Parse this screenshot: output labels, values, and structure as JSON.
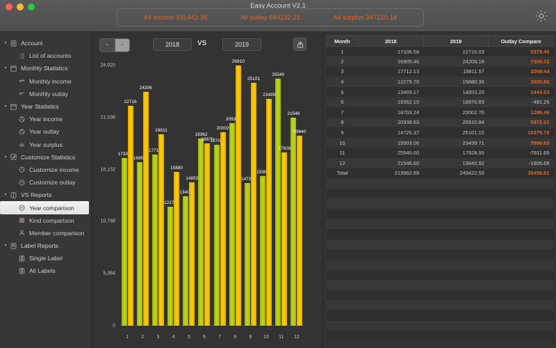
{
  "window": {
    "title": "Easy Account V2.1",
    "traffic_lights": [
      "close",
      "minimize",
      "zoom"
    ],
    "gear_icon": "gear-icon"
  },
  "summary": {
    "income": "All income 931442.35",
    "outlay": "All outlay 684232.21",
    "surplus": "All surplus 247210.14",
    "accent_color": "#e8651b"
  },
  "sidebar": {
    "items": [
      {
        "label": "Account",
        "level": "group",
        "icon": "list-icon",
        "caret": "▾",
        "selected": false
      },
      {
        "label": "List of accounts",
        "level": "child",
        "icon": "accounts-icon",
        "caret": "",
        "selected": false
      },
      {
        "label": "Monthly Statistics",
        "level": "group",
        "icon": "calendar-30-icon",
        "caret": "▾",
        "selected": false
      },
      {
        "label": "Monthly income",
        "level": "child",
        "icon": "income-plus-icon",
        "caret": "",
        "selected": false
      },
      {
        "label": "Monthly outlay",
        "level": "child",
        "icon": "outlay-minus-icon",
        "caret": "",
        "selected": false
      },
      {
        "label": "Year Statistics",
        "level": "group",
        "icon": "calendar-12-icon",
        "caret": "▾",
        "selected": false
      },
      {
        "label": "Year income",
        "level": "child",
        "icon": "pie-chart-icon",
        "caret": "",
        "selected": false
      },
      {
        "label": "Year outlay",
        "level": "child",
        "icon": "pie-chart-icon",
        "caret": "",
        "selected": false
      },
      {
        "label": "Year surplus",
        "level": "child",
        "icon": "bar-chart-icon",
        "caret": "",
        "selected": false
      },
      {
        "label": "Customize Statistics",
        "level": "group",
        "icon": "edit-box-icon",
        "caret": "▾",
        "selected": false
      },
      {
        "label": "Customize income",
        "level": "child",
        "icon": "clock-pie-icon",
        "caret": "",
        "selected": false
      },
      {
        "label": "Customize outlay",
        "level": "child",
        "icon": "clock-pie-icon",
        "caret": "",
        "selected": false
      },
      {
        "label": "VS Reports",
        "level": "group",
        "icon": "compare-icon",
        "caret": "▾",
        "selected": false
      },
      {
        "label": "Year comparison",
        "level": "child",
        "icon": "vs-circle-icon",
        "caret": "",
        "selected": true
      },
      {
        "label": "Kind comparison",
        "level": "child",
        "icon": "four-dots-icon",
        "caret": "",
        "selected": false
      },
      {
        "label": "Member comparison",
        "level": "child",
        "icon": "person-icon",
        "caret": "",
        "selected": false
      },
      {
        "label": "Label Reports",
        "level": "group",
        "icon": "bookmark-box-icon",
        "caret": "▾",
        "selected": false
      },
      {
        "label": "Single Label",
        "level": "child",
        "icon": "bookmark-icon",
        "caret": "",
        "selected": false
      },
      {
        "label": "All Labels",
        "level": "child",
        "icon": "bookmark-icon",
        "caret": "",
        "selected": false
      }
    ]
  },
  "toolbar": {
    "zoom_out": "-",
    "zoom_in": "-",
    "year_left": "2018",
    "year_right": "2019",
    "vs_label": "VS",
    "export_icon": "export-icon"
  },
  "chart_data": {
    "type": "bar",
    "title": "",
    "xlabel": "",
    "ylabel": "",
    "ylim": [
      0,
      26920
    ],
    "grid": false,
    "legend_position": "none",
    "categories": [
      "1",
      "2",
      "3",
      "4",
      "5",
      "6",
      "7",
      "8",
      "9",
      "10",
      "11",
      "12"
    ],
    "yticks": [
      "0",
      "5,384",
      "10,768",
      "16,152",
      "21,536",
      "26,920"
    ],
    "ytick_values": [
      0,
      5384,
      10768,
      16152,
      21536,
      26920
    ],
    "series": [
      {
        "name": "2018",
        "color": "#b5c911",
        "values": [
          17336,
          16905,
          17712,
          12279,
          13409,
          19362,
          18703,
          20938,
          14725,
          15503,
          25540,
          21546
        ],
        "labels": [
          "17336",
          "16905",
          "17712",
          "12279",
          "13409",
          "19362",
          "18703",
          "20938",
          "14725",
          "15503",
          "25540",
          "21546"
        ]
      },
      {
        "name": "2019",
        "color": "#fcc800",
        "values": [
          22716,
          24206,
          19811,
          15880,
          14853,
          18870,
          20002,
          26910,
          25101,
          23499,
          17928,
          19640
        ],
        "labels": [
          "22716",
          "24206",
          "19811",
          "15880",
          "14853",
          "18870",
          "20002",
          "26910",
          "25101",
          "23499",
          "17928",
          "19640"
        ]
      }
    ]
  },
  "table": {
    "columns": [
      "Month",
      "2018",
      "2019",
      "Outlay Compare"
    ],
    "rows": [
      {
        "month": "1",
        "y2018": "17336.58",
        "y2019": "22716.03",
        "compare": "5379.45",
        "positive": true
      },
      {
        "month": "2",
        "y2018": "16905.46",
        "y2019": "24206.18",
        "compare": "7300.72",
        "positive": true
      },
      {
        "month": "3",
        "y2018": "17712.13",
        "y2019": "19811.57",
        "compare": "2099.44",
        "positive": true
      },
      {
        "month": "4",
        "y2018": "12279.70",
        "y2019": "15880.36",
        "compare": "3600.66",
        "positive": true
      },
      {
        "month": "5",
        "y2018": "13409.17",
        "y2019": "14853.20",
        "compare": "1444.03",
        "positive": true
      },
      {
        "month": "6",
        "y2018": "19362.15",
        "y2019": "18870.89",
        "compare": "-491.26",
        "positive": false
      },
      {
        "month": "7",
        "y2018": "18703.24",
        "y2019": "20002.70",
        "compare": "1299.46",
        "positive": true
      },
      {
        "month": "8",
        "y2018": "20938.63",
        "y2019": "26910.84",
        "compare": "5972.21",
        "positive": true
      },
      {
        "month": "9",
        "y2018": "14725.37",
        "y2019": "25101.15",
        "compare": "10375.78",
        "positive": true
      },
      {
        "month": "10",
        "y2018": "15503.06",
        "y2019": "23499.71",
        "compare": "7996.65",
        "positive": true
      },
      {
        "month": "11",
        "y2018": "25540.60",
        "y2019": "17928.95",
        "compare": "-7611.65",
        "positive": false
      },
      {
        "month": "12",
        "y2018": "21546.60",
        "y2019": "19640.92",
        "compare": "-1905.68",
        "positive": false
      },
      {
        "month": "Total",
        "y2018": "213962.69",
        "y2019": "249422.50",
        "compare": "35459.81",
        "positive": true
      }
    ]
  }
}
